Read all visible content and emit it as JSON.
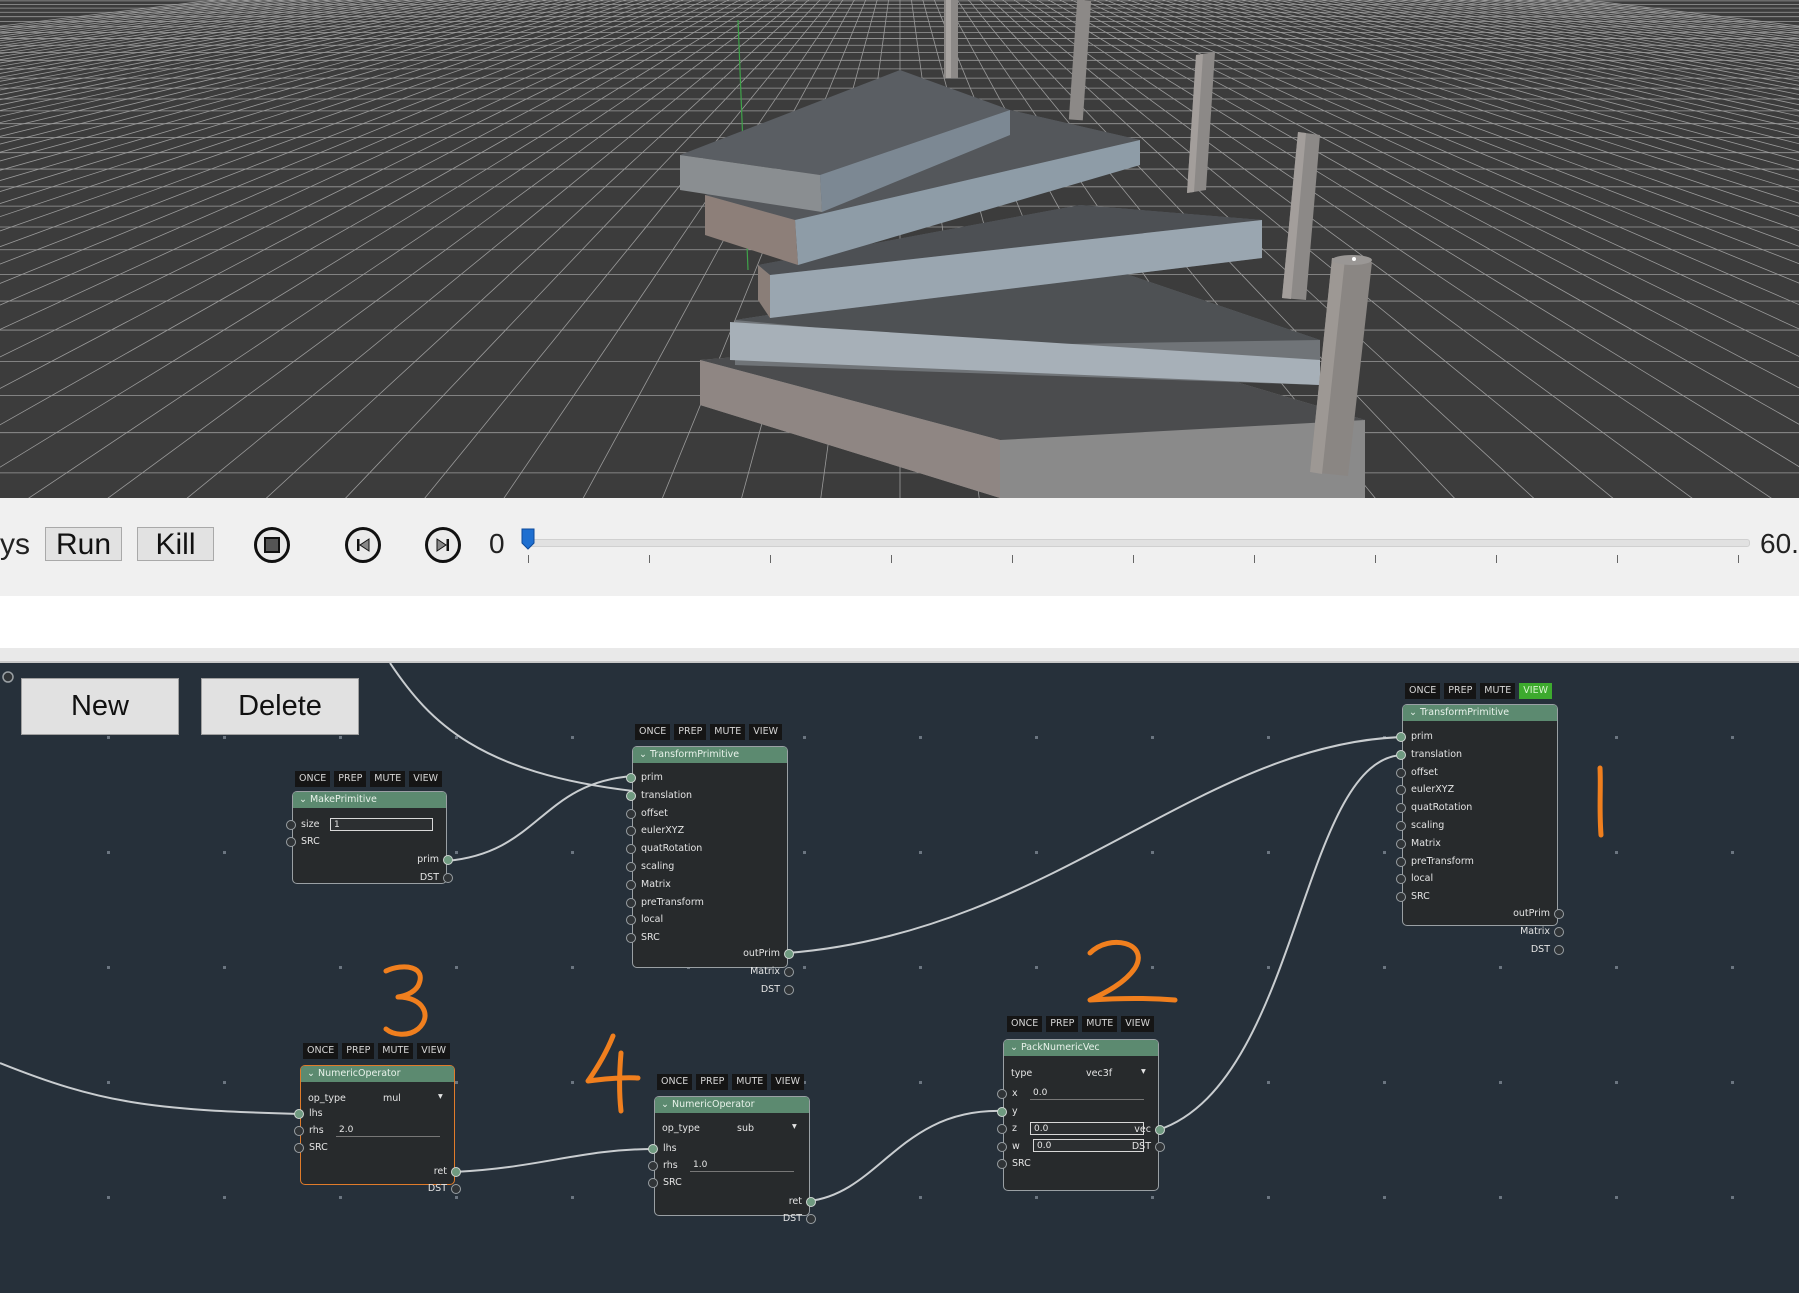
{
  "controls": {
    "left_text": "ys",
    "run_label": "Run",
    "kill_label": "Kill",
    "frame_start": "0",
    "frame_end": "60.",
    "stop_icon": "stop-icon",
    "prev_icon": "step-back-icon",
    "next_icon": "step-forward-icon",
    "slider_value": 0
  },
  "graph_toolbar": {
    "new_label": "New",
    "delete_label": "Delete"
  },
  "flags": {
    "once": "ONCE",
    "prep": "PREP",
    "mute": "MUTE",
    "view": "VIEW"
  },
  "nodes": {
    "make_primitive": {
      "title": "MakePrimitive",
      "inputs": [
        "size",
        "SRC"
      ],
      "size_value": "1",
      "outputs": [
        "prim",
        "DST"
      ]
    },
    "transform_a": {
      "title": "TransformPrimitive",
      "inputs": [
        "prim",
        "translation",
        "offset",
        "eulerXYZ",
        "quatRotation",
        "scaling",
        "Matrix",
        "preTransform",
        "local",
        "SRC"
      ],
      "outputs": [
        "outPrim",
        "Matrix",
        "DST"
      ]
    },
    "transform_b": {
      "title": "TransformPrimitive",
      "inputs": [
        "prim",
        "translation",
        "offset",
        "eulerXYZ",
        "quatRotation",
        "scaling",
        "Matrix",
        "preTransform",
        "local",
        "SRC"
      ],
      "outputs": [
        "outPrim",
        "Matrix",
        "DST"
      ],
      "view_on": true
    },
    "numeric_mul": {
      "title": "NumericOperator",
      "op_label": "op_type",
      "op_value": "mul",
      "inputs": [
        "lhs",
        "rhs",
        "SRC"
      ],
      "rhs_value": "2.0",
      "outputs": [
        "ret",
        "DST"
      ]
    },
    "numeric_sub": {
      "title": "NumericOperator",
      "op_label": "op_type",
      "op_value": "sub",
      "inputs": [
        "lhs",
        "rhs",
        "SRC"
      ],
      "rhs_value": "1.0",
      "outputs": [
        "ret",
        "DST"
      ]
    },
    "pack_vec": {
      "title": "PackNumericVec",
      "type_label": "type",
      "type_value": "vec3f",
      "inputs": [
        "x",
        "y",
        "z",
        "w",
        "SRC"
      ],
      "x_value": "0.0",
      "z_value": "0.0",
      "w_value": "0.0",
      "outputs": [
        "vec",
        "DST"
      ]
    }
  },
  "annotations": {
    "color": "#f07f1e"
  },
  "colors": {
    "graph_bg": "#26303a",
    "node_header": "#5c8a70",
    "selected_border": "#e07b2a",
    "view_on": "#3daa2e",
    "slider_accent": "#1e6fd0"
  }
}
